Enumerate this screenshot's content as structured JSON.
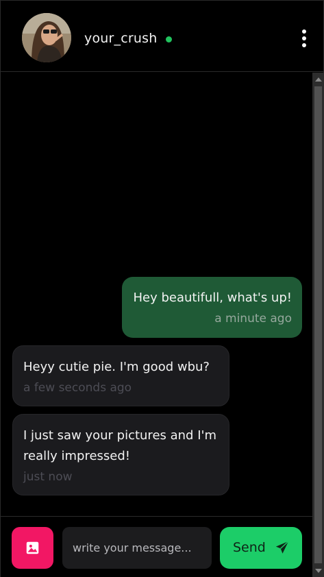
{
  "header": {
    "contact_name": "your_crush",
    "status": "online",
    "avatar_icon": "profile-photo",
    "menu_icon": "more-vertical-icon"
  },
  "messages": [
    {
      "direction": "sent",
      "text": "Hey beautifull, what's up!",
      "time": "a minute ago"
    },
    {
      "direction": "received",
      "text": "Heyy cutie pie. I'm good wbu?",
      "time": "a few seconds ago"
    },
    {
      "direction": "received",
      "text": "I just saw your pictures and I'm really impressed!",
      "time": "just now"
    }
  ],
  "composer": {
    "placeholder": "write your message...",
    "value": "",
    "send_label": "Send",
    "image_icon": "image-icon",
    "send_icon": "paper-plane-icon"
  },
  "colors": {
    "online": "#21c35e",
    "sent_bubble": "#1f5a36",
    "received_bubble": "#1b1b1e",
    "image_button": "#f21764",
    "send_button": "#1ccd68"
  }
}
